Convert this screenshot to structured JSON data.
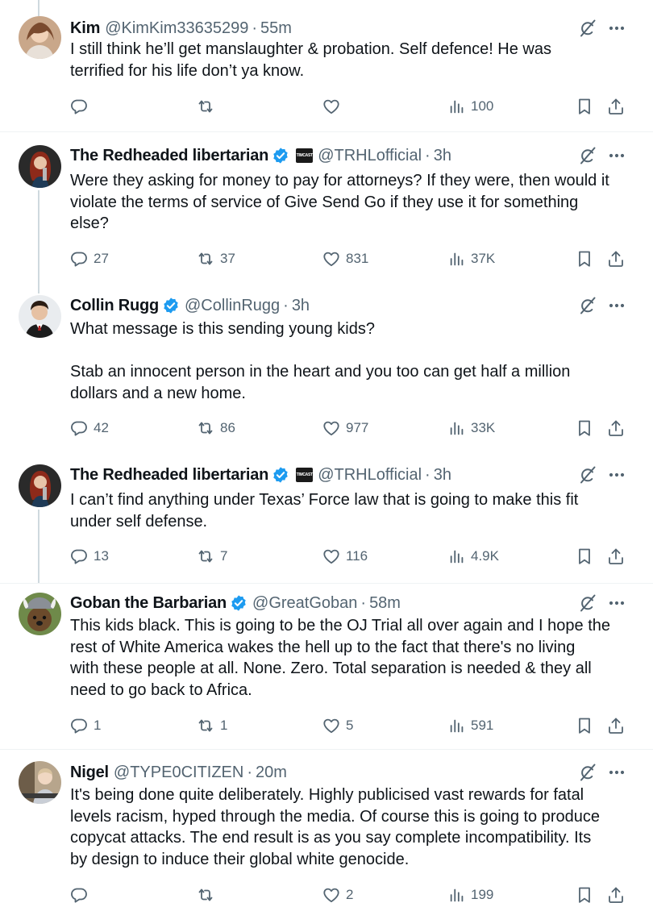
{
  "tweets": [
    {
      "name": "Kim",
      "verified": false,
      "badge": "",
      "handle": "@KimKim33635299",
      "time": "55m",
      "text": "I still think he’ll get manslaughter & probation. Self defence!  He was\nterrified for his life don’t ya know.",
      "replies": "",
      "retweets": "",
      "likes": "",
      "views": "100"
    },
    {
      "name": "The Redheaded libertarian",
      "verified": true,
      "badge": "TIMCAST",
      "handle": "@TRHLofficial",
      "time": "3h",
      "text": "Were they asking for money to pay for attorneys? If they were, then would it\nviolate the terms of service of Give Send Go if they use it for something\nelse?",
      "replies": "27",
      "retweets": "37",
      "likes": "831",
      "views": "37K"
    },
    {
      "name": "Collin Rugg",
      "verified": true,
      "badge": "",
      "handle": "@CollinRugg",
      "time": "3h",
      "text": "What message is this sending young kids?\n\nStab an innocent person in the heart and you too can get half a million\ndollars and a new home.",
      "replies": "42",
      "retweets": "86",
      "likes": "977",
      "views": "33K"
    },
    {
      "name": "The Redheaded libertarian",
      "verified": true,
      "badge": "TIMCAST",
      "handle": "@TRHLofficial",
      "time": "3h",
      "text": "I can’t find anything under Texas’ Force law that is going to make this fit\nunder self defense.",
      "replies": "13",
      "retweets": "7",
      "likes": "116",
      "views": "4.9K"
    },
    {
      "name": "Goban the Barbarian",
      "verified": true,
      "badge": "",
      "handle": "@GreatGoban",
      "time": "58m",
      "text": "This kids black. This is going to be the OJ Trial all over again and I hope the\nrest of White America wakes the hell up to the fact that there's no living\nwith these people at all. None. Zero. Total separation is needed & they all\nneed to go back to Africa.",
      "replies": "1",
      "retweets": "1",
      "likes": "5",
      "views": "591"
    },
    {
      "name": "Nigel",
      "verified": false,
      "badge": "",
      "handle": "@TYPE0CITIZEN",
      "time": "20m",
      "text": "It's being done quite deliberately.  Highly publicised vast rewards for fatal\nlevels racism, hyped through the media.  Of course this is going to produce\ncopycat attacks.  The end result is as you say complete incompatibility.  Its\nby design to induce their global white genocide.",
      "replies": "",
      "retweets": "",
      "likes": "2",
      "views": "199"
    }
  ],
  "separator": "·",
  "icons": {
    "reply": "reply-icon",
    "retweet": "retweet-icon",
    "like": "heart-icon",
    "views": "views-icon",
    "bookmark": "bookmark-icon",
    "share": "share-icon",
    "grok": "grok-icon",
    "more": "more-icon",
    "verified": "verified-badge-icon"
  },
  "colors": {
    "text": "#0f1419",
    "secondary": "#536471",
    "verified": "#1d9bf0",
    "divider": "#eff3f4",
    "thread_line": "#cfd9de"
  }
}
